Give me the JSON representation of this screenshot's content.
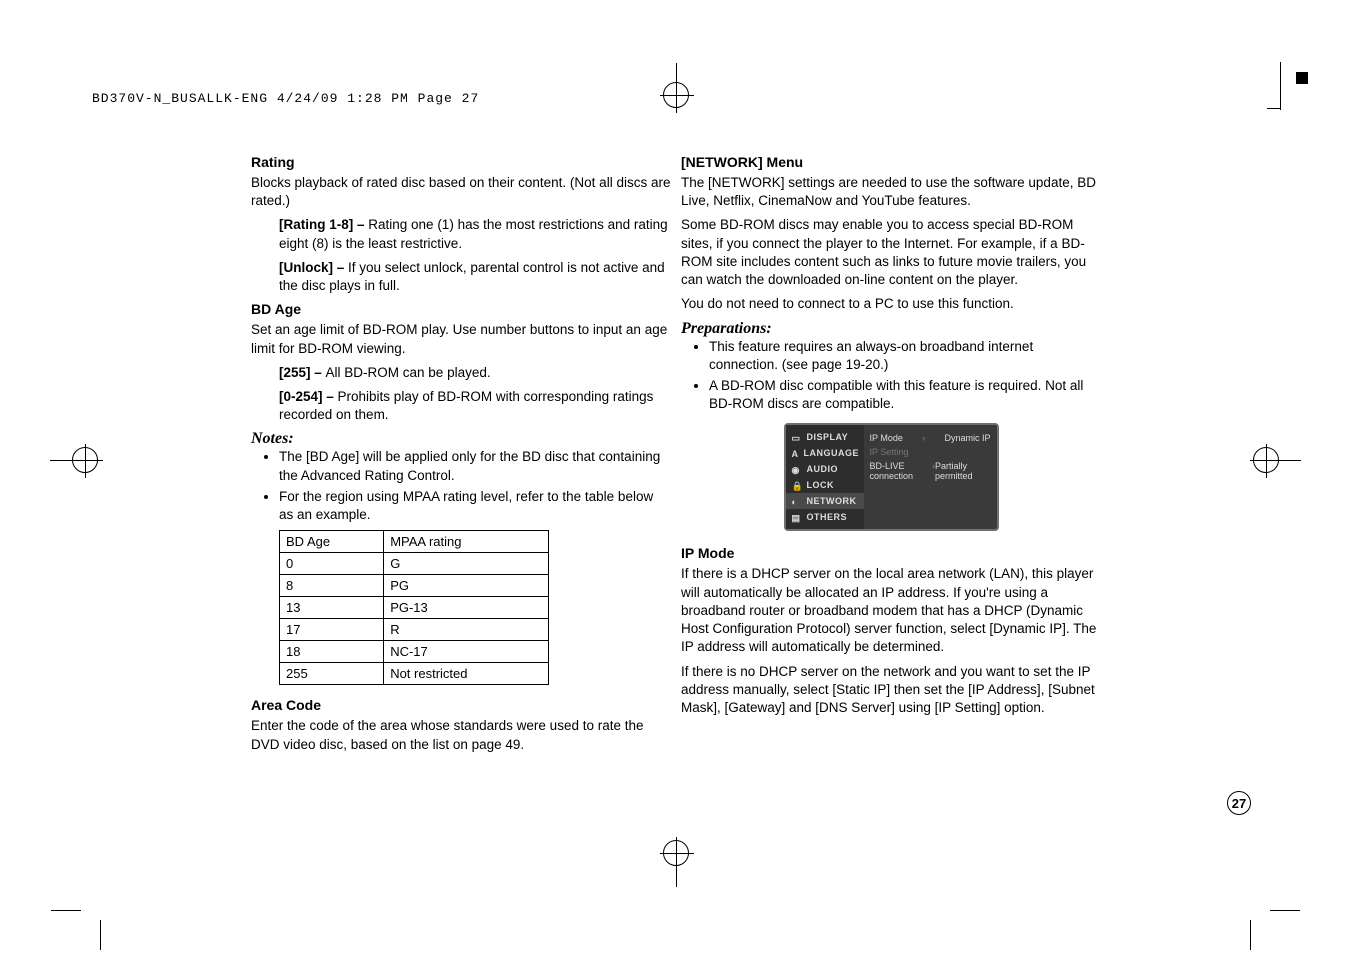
{
  "print_header": "BD370V-N_BUSALLK-ENG  4/24/09  1:28 PM  Page 27",
  "page_number": "27",
  "left": {
    "rating": {
      "head": "Rating",
      "desc": "Blocks playback of rated disc based on their content. (Not all discs are rated.)",
      "opt1_label": "[Rating 1-8] – ",
      "opt1_text": "Rating one (1) has the most restrictions and rating eight (8) is the least restrictive.",
      "opt2_label": "[Unlock] – ",
      "opt2_text": "If you select unlock, parental control is not active and the disc plays in full."
    },
    "bdage": {
      "head": "BD Age",
      "desc": "Set an age limit of BD-ROM play. Use number buttons to input an age limit for BD-ROM viewing.",
      "opt1_label": "[255] – ",
      "opt1_text": "All BD-ROM can be played.",
      "opt2_label": "[0-254] – ",
      "opt2_text": "Prohibits play of BD-ROM with corresponding ratings recorded on them."
    },
    "notes": {
      "head": "Notes:",
      "n1": "The [BD Age] will be applied only for the BD disc that containing the Advanced Rating Control.",
      "n2": "For the region using MPAA rating level, refer to the table below as an example."
    },
    "table": {
      "h1": "BD Age",
      "h2": "MPAA rating",
      "rows": [
        {
          "a": "0",
          "b": "G"
        },
        {
          "a": "8",
          "b": "PG"
        },
        {
          "a": "13",
          "b": "PG-13"
        },
        {
          "a": "17",
          "b": "R"
        },
        {
          "a": "18",
          "b": "NC-17"
        },
        {
          "a": "255",
          "b": "Not restricted"
        }
      ]
    },
    "area": {
      "head": "Area Code",
      "desc": "Enter the code of the area whose standards were used to rate the DVD video disc, based on the list on page 49."
    }
  },
  "right": {
    "network": {
      "head": "[NETWORK] Menu",
      "p1": "The [NETWORK] settings are needed to use the software update, BD Live, Netflix, CinemaNow and YouTube features.",
      "p2": "Some BD-ROM discs may enable you to access special BD-ROM sites, if you connect the player to the Internet. For example, if a BD-ROM site includes content such as links to future movie trailers, you can watch the downloaded on-line content on the player.",
      "p3": "You do not need to connect to a PC to use this function."
    },
    "prep": {
      "head": "Preparations:",
      "b1": "This feature requires an always-on broadband internet connection. (see page 19-20.)",
      "b2": "A BD-ROM disc compatible with this feature is required. Not all BD-ROM discs are compatible."
    },
    "setup": {
      "side": {
        "display": "DISPLAY",
        "language": "LANGUAGE",
        "audio": "AUDIO",
        "lock": "LOCK",
        "network": "NETWORK",
        "others": "OTHERS"
      },
      "r1a": "IP Mode",
      "r1b": "Dynamic IP",
      "r2a": "IP Setting",
      "r3a": "BD-LIVE connection",
      "r3b": "Partially permitted"
    },
    "ipmode": {
      "head": "IP Mode",
      "p1": "If there is a DHCP server on the local area network (LAN), this player will automatically be allocated an IP address. If you're using a broadband router or broadband modem that has a DHCP (Dynamic Host Configuration Protocol) server function, select [Dynamic IP]. The IP address will automatically be determined.",
      "p2": "If there is no DHCP server on the network and you want to set the IP address manually, select [Static IP] then set the [IP Address], [Subnet Mask], [Gateway] and [DNS Server] using [IP Setting] option."
    }
  }
}
